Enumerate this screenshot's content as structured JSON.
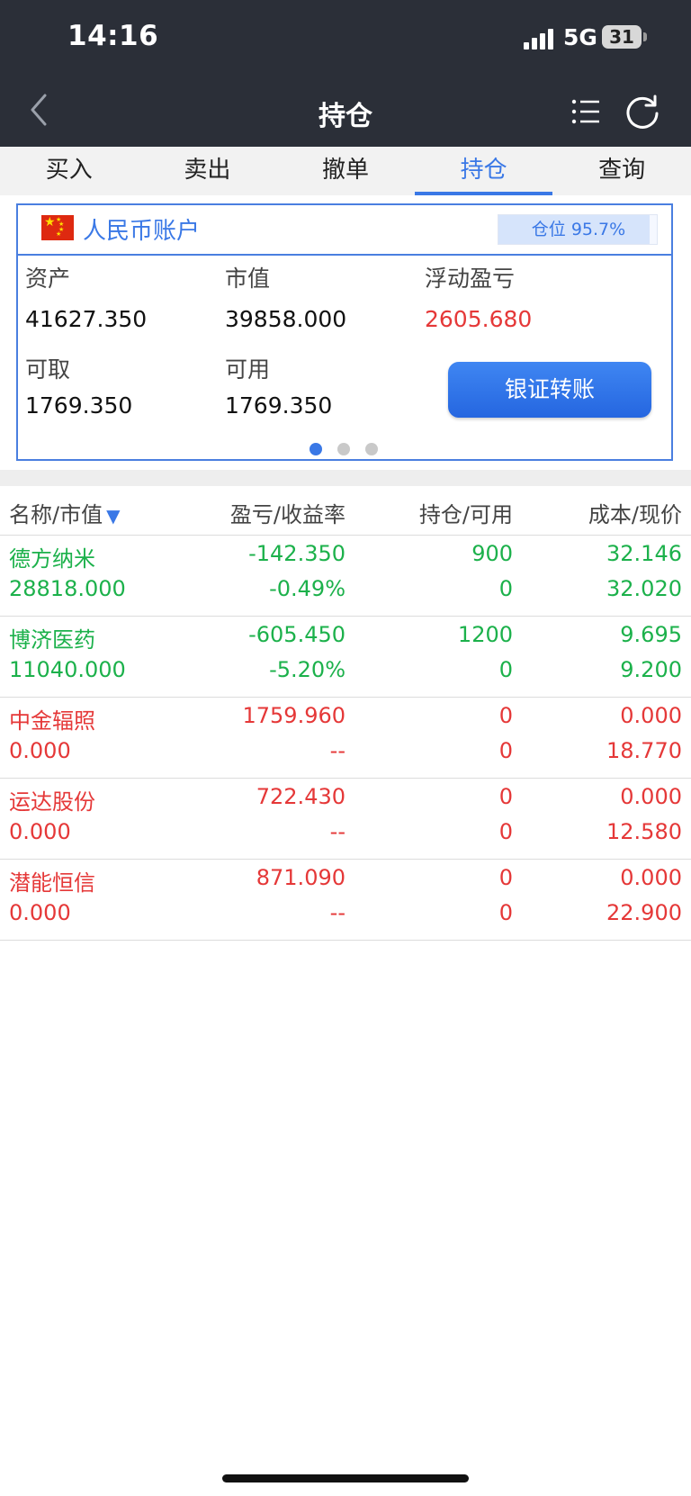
{
  "status": {
    "time": "14:16",
    "network": "5G",
    "battery": "31"
  },
  "nav": {
    "title": "持仓"
  },
  "tabs": [
    {
      "label": "买入"
    },
    {
      "label": "卖出"
    },
    {
      "label": "撤单"
    },
    {
      "label": "持仓",
      "active": true
    },
    {
      "label": "查询"
    }
  ],
  "account": {
    "name": "人民币账户",
    "position_label": "仓位 95.7%",
    "position_fraction": 0.957,
    "assets_label": "资产",
    "assets_value": "41627.350",
    "market_label": "市值",
    "market_value": "39858.000",
    "float_label": "浮动盈亏",
    "float_value": "2605.680",
    "withdrawable_label": "可取",
    "withdrawable_value": "1769.350",
    "available_label": "可用",
    "available_value": "1769.350",
    "transfer_button": "银证转账",
    "pages": 3,
    "current_page": 1
  },
  "table": {
    "headers": {
      "name": "名称/市值",
      "sort_icon": "▼",
      "pl": "盈亏/收益率",
      "hold": "持仓/可用",
      "cost": "成本/现价"
    },
    "rows": [
      {
        "name": "德方纳米",
        "market_value": "28818.000",
        "pl": "-142.350",
        "rate": "-0.49%",
        "hold": "900",
        "available": "0",
        "cost": "32.146",
        "price": "32.020",
        "color": "green"
      },
      {
        "name": "博济医药",
        "market_value": "11040.000",
        "pl": "-605.450",
        "rate": "-5.20%",
        "hold": "1200",
        "available": "0",
        "cost": "9.695",
        "price": "9.200",
        "color": "green"
      },
      {
        "name": "中金辐照",
        "market_value": "0.000",
        "pl": "1759.960",
        "rate": "--",
        "hold": "0",
        "available": "0",
        "cost": "0.000",
        "price": "18.770",
        "color": "red"
      },
      {
        "name": "运达股份",
        "market_value": "0.000",
        "pl": "722.430",
        "rate": "--",
        "hold": "0",
        "available": "0",
        "cost": "0.000",
        "price": "12.580",
        "color": "red"
      },
      {
        "name": "潜能恒信",
        "market_value": "0.000",
        "pl": "871.090",
        "rate": "--",
        "hold": "0",
        "available": "0",
        "cost": "0.000",
        "price": "22.900",
        "color": "red"
      }
    ]
  },
  "colors": {
    "accent": "#3a78e6",
    "up": "#e53838",
    "down": "#1cb14b",
    "header_bg": "#2b2f38"
  }
}
